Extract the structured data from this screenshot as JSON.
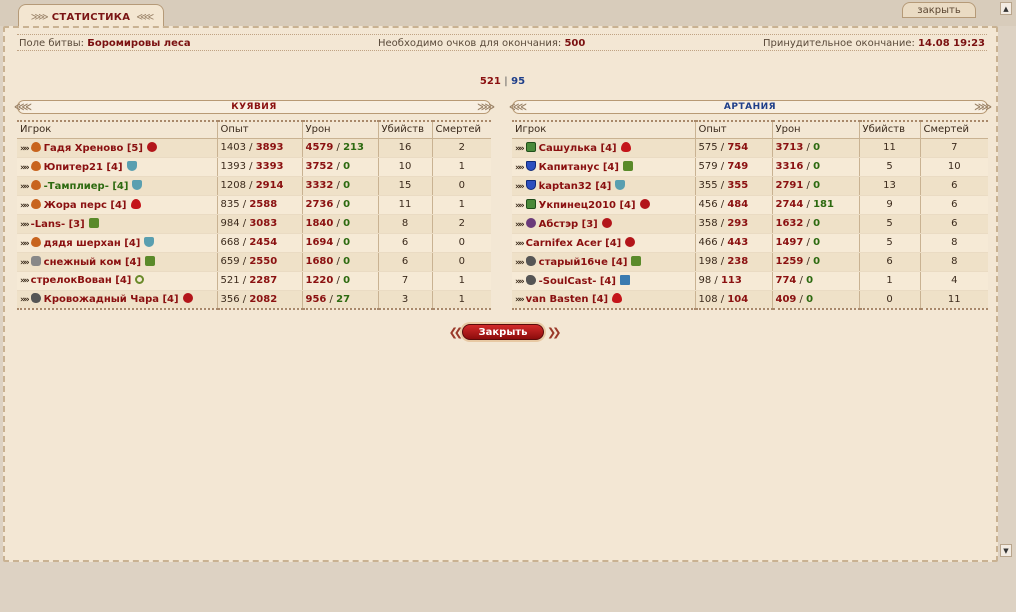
{
  "header": {
    "tab_title": "СТАТИСТИКА",
    "close_top": "закрыть"
  },
  "info": {
    "battlefield_label": "Поле битвы:",
    "battlefield_value": "Боромировы леса",
    "points_label": "Необходимо очков для окончания:",
    "points_value": "500",
    "forced_label": "Принудительное окончание:",
    "forced_value": "14.08 19:23"
  },
  "score": {
    "left": "521",
    "sep": "|",
    "right": "95"
  },
  "columns": [
    "Игрок",
    "Опыт",
    "Урон",
    "Убийств",
    "Смертей"
  ],
  "teams": [
    {
      "name": "КУЯВИЯ",
      "players": [
        {
          "name": "Гадя Хреново [5]",
          "icon": "drop-icon",
          "badge": "skull",
          "name_color": "red",
          "exp1": "1403",
          "exp2": "3893",
          "dmg1": "4579",
          "dmg2": "213",
          "kills": "16",
          "deaths": "2"
        },
        {
          "name": "Юпитер21 [4]",
          "icon": "drop-icon",
          "badge": "shield",
          "name_color": "red",
          "exp1": "1393",
          "exp2": "3393",
          "dmg1": "3752",
          "dmg2": "0",
          "kills": "10",
          "deaths": "1"
        },
        {
          "name": "-Тамплиер- [4]",
          "icon": "drop-icon",
          "badge": "shield",
          "name_color": "green",
          "exp1": "1208",
          "exp2": "2914",
          "dmg1": "3332",
          "dmg2": "0",
          "kills": "15",
          "deaths": "0"
        },
        {
          "name": "Жора перс [4]",
          "icon": "drop-icon",
          "badge": "fire",
          "name_color": "red",
          "exp1": "835",
          "exp2": "2588",
          "dmg1": "2736",
          "dmg2": "0",
          "kills": "11",
          "deaths": "1"
        },
        {
          "name": "-Lans- [3]",
          "icon": "",
          "badge": "tree",
          "name_color": "red",
          "exp1": "984",
          "exp2": "3083",
          "dmg1": "1840",
          "dmg2": "0",
          "kills": "8",
          "deaths": "2"
        },
        {
          "name": "дядя шерхан [4]",
          "icon": "drop-icon",
          "badge": "shield",
          "name_color": "red",
          "exp1": "668",
          "exp2": "2454",
          "dmg1": "1694",
          "dmg2": "0",
          "kills": "6",
          "deaths": "0"
        },
        {
          "name": "снежный ком [4]",
          "icon": "wolf-icon",
          "badge": "tree",
          "name_color": "red",
          "exp1": "659",
          "exp2": "2550",
          "dmg1": "1680",
          "dmg2": "0",
          "kills": "6",
          "deaths": "0"
        },
        {
          "name": "стрелокВован [4]",
          "icon": "",
          "badge": "cross",
          "name_color": "red",
          "exp1": "521",
          "exp2": "2287",
          "dmg1": "1220",
          "dmg2": "0",
          "kills": "7",
          "deaths": "1"
        },
        {
          "name": "Кровожадный Чара [4]",
          "icon": "dragon-icon",
          "badge": "skull",
          "name_color": "red",
          "exp1": "356",
          "exp2": "2082",
          "dmg1": "956",
          "dmg2": "27",
          "kills": "3",
          "deaths": "1"
        }
      ]
    },
    {
      "name": "АРТАНИЯ",
      "players": [
        {
          "name": "Сашулька [4]",
          "icon": "green-shield-icon",
          "badge": "fire",
          "name_color": "red",
          "exp1": "575",
          "exp2": "754",
          "dmg1": "3713",
          "dmg2": "0",
          "kills": "11",
          "deaths": "7"
        },
        {
          "name": "Капитанус [4]",
          "icon": "blue-shield-icon",
          "badge": "tree",
          "name_color": "red",
          "exp1": "579",
          "exp2": "749",
          "dmg1": "3316",
          "dmg2": "0",
          "kills": "5",
          "deaths": "10"
        },
        {
          "name": "kaptan32 [4]",
          "icon": "blue-shield-icon",
          "badge": "shield",
          "name_color": "red",
          "exp1": "355",
          "exp2": "355",
          "dmg1": "2791",
          "dmg2": "0",
          "kills": "13",
          "deaths": "6"
        },
        {
          "name": "Укпинец2010 [4]",
          "icon": "green-shield-icon",
          "badge": "skull",
          "name_color": "red",
          "exp1": "456",
          "exp2": "484",
          "dmg1": "2744",
          "dmg2": "181",
          "kills": "9",
          "deaths": "6"
        },
        {
          "name": "Абстэр [3]",
          "icon": "skull-icon",
          "badge": "skull",
          "name_color": "red",
          "exp1": "358",
          "exp2": "293",
          "dmg1": "1632",
          "dmg2": "0",
          "kills": "5",
          "deaths": "6"
        },
        {
          "name": "Carnifex Acer [4]",
          "icon": "",
          "badge": "skull",
          "name_color": "red",
          "exp1": "466",
          "exp2": "443",
          "dmg1": "1497",
          "dmg2": "0",
          "kills": "5",
          "deaths": "8"
        },
        {
          "name": "старый16че [4]",
          "icon": "lion-icon",
          "badge": "tree",
          "name_color": "red",
          "exp1": "198",
          "exp2": "238",
          "dmg1": "1259",
          "dmg2": "0",
          "kills": "6",
          "deaths": "8"
        },
        {
          "name": "-SoulCast- [4]",
          "icon": "dragon-icon",
          "badge": "sword",
          "name_color": "red",
          "exp1": "98",
          "exp2": "113",
          "dmg1": "774",
          "dmg2": "0",
          "kills": "1",
          "deaths": "4"
        },
        {
          "name": "van Basten [4]",
          "icon": "",
          "badge": "fire",
          "name_color": "red",
          "exp1": "108",
          "exp2": "104",
          "dmg1": "409",
          "dmg2": "0",
          "kills": "0",
          "deaths": "11"
        }
      ]
    }
  ],
  "footer": {
    "close_label": "Закрыть"
  }
}
